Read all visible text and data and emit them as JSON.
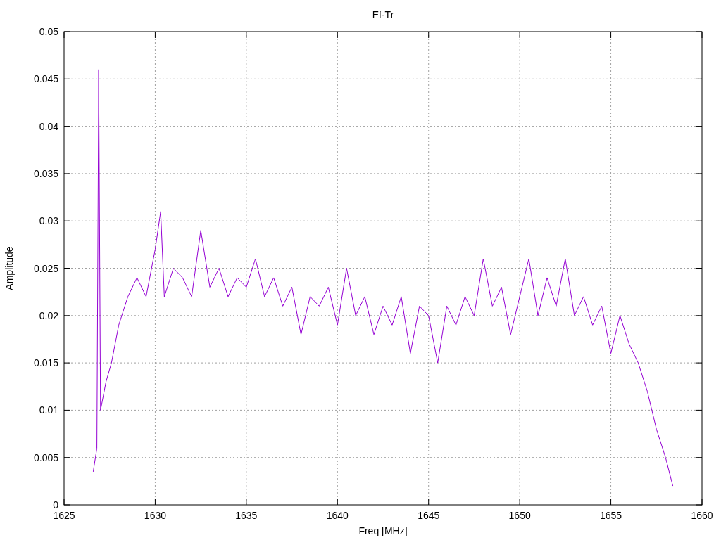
{
  "chart_data": {
    "type": "line",
    "grid": true,
    "title": "Ef-Tr",
    "xlabel": "Freq [MHz]",
    "ylabel": "Amplitude",
    "xlim": [
      1625,
      1660
    ],
    "ylim": [
      0,
      0.05
    ],
    "xticks": [
      1625,
      1630,
      1635,
      1640,
      1645,
      1650,
      1655,
      1660
    ],
    "yticks": [
      0,
      0.005,
      0.01,
      0.015,
      0.02,
      0.025,
      0.03,
      0.035,
      0.04,
      0.045,
      0.05
    ],
    "x": [
      1626.6,
      1626.8,
      1626.9,
      1627.0,
      1627.3,
      1627.6,
      1628.0,
      1628.5,
      1629.0,
      1629.5,
      1630.0,
      1630.3,
      1630.5,
      1631,
      1631.5,
      1632,
      1632.5,
      1633,
      1633.5,
      1634,
      1634.5,
      1635,
      1635.5,
      1636,
      1636.5,
      1637,
      1637.5,
      1638,
      1638.5,
      1639,
      1639.5,
      1640,
      1640.5,
      1641,
      1641.5,
      1642,
      1642.5,
      1643,
      1643.5,
      1644,
      1644.5,
      1645,
      1645.5,
      1646,
      1646.5,
      1647,
      1647.5,
      1648,
      1648.5,
      1649,
      1649.5,
      1650,
      1650.5,
      1651,
      1651.5,
      1652,
      1652.5,
      1653,
      1653.5,
      1654,
      1654.5,
      1655,
      1655.5,
      1656,
      1656.5,
      1657,
      1657.5,
      1658,
      1658.4
    ],
    "series": [
      {
        "color": "#9400d3",
        "values": [
          0.0035,
          0.006,
          0.046,
          0.01,
          0.013,
          0.015,
          0.019,
          0.022,
          0.024,
          0.022,
          0.027,
          0.031,
          0.022,
          0.025,
          0.024,
          0.022,
          0.029,
          0.023,
          0.025,
          0.022,
          0.024,
          0.023,
          0.026,
          0.022,
          0.024,
          0.021,
          0.023,
          0.018,
          0.022,
          0.021,
          0.023,
          0.019,
          0.025,
          0.02,
          0.022,
          0.018,
          0.021,
          0.019,
          0.022,
          0.016,
          0.021,
          0.02,
          0.015,
          0.021,
          0.019,
          0.022,
          0.02,
          0.026,
          0.021,
          0.023,
          0.018,
          0.022,
          0.026,
          0.02,
          0.024,
          0.021,
          0.026,
          0.02,
          0.022,
          0.019,
          0.021,
          0.016,
          0.02,
          0.017,
          0.015,
          0.012,
          0.008,
          0.005,
          0.002
        ]
      }
    ]
  }
}
